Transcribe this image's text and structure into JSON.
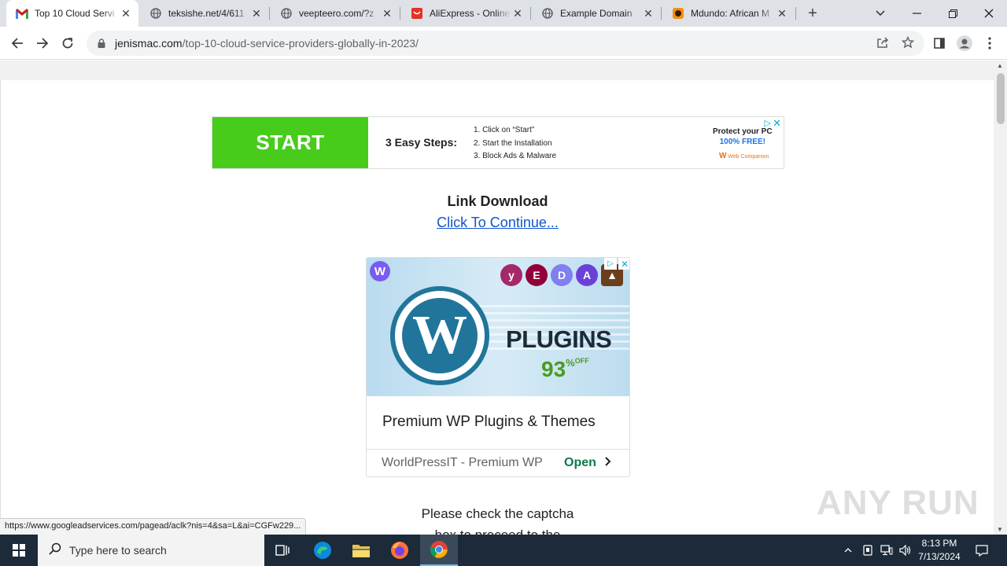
{
  "browser": {
    "tabs": [
      {
        "title": "Top 10 Cloud Servi",
        "favicon": "gmail-m-icon",
        "active": true
      },
      {
        "title": "teksishe.net/4/611",
        "favicon": "globe-icon",
        "active": false
      },
      {
        "title": "veepteero.com/?z",
        "favicon": "globe-icon",
        "active": false
      },
      {
        "title": "AliExpress - Online",
        "favicon": "aliexpress-icon",
        "active": false
      },
      {
        "title": "Example Domain",
        "favicon": "globe-icon",
        "active": false
      },
      {
        "title": "Mdundo: African M",
        "favicon": "mdundo-icon",
        "active": false
      }
    ],
    "url_host": "jenismac.com",
    "url_path": "/top-10-cloud-service-providers-globally-in-2023/"
  },
  "banner_ad": {
    "start_label": "START",
    "steps_title": "3 Easy Steps:",
    "steps": [
      "1. Click on “Start”",
      "2. Start the Installation",
      "3. Block Ads & Malware"
    ],
    "protect_line1": "Protect your PC",
    "protect_line2": "100% FREE!",
    "brand": "Web Companion"
  },
  "content": {
    "link_download": "Link Download",
    "continue_link": "Click To Continue...",
    "captcha_line1": "Please check the captcha",
    "captcha_line2": "box to proceed to the"
  },
  "wp_ad": {
    "plugins_text": "PLUGINS",
    "discount": "93",
    "discount_suffix": "%",
    "off": "OFF",
    "headline": "Premium WP Plugins & Themes",
    "advertiser": "WorldPressIT - Premium WP",
    "cta": "Open"
  },
  "status_url": "https://www.googleadservices.com/pagead/aclk?nis=4&sa=L&ai=CGFw229...",
  "watermark": "ANY RUN",
  "taskbar": {
    "search_placeholder": "Type here to search",
    "time": "8:13 PM",
    "date": "7/13/2024"
  }
}
